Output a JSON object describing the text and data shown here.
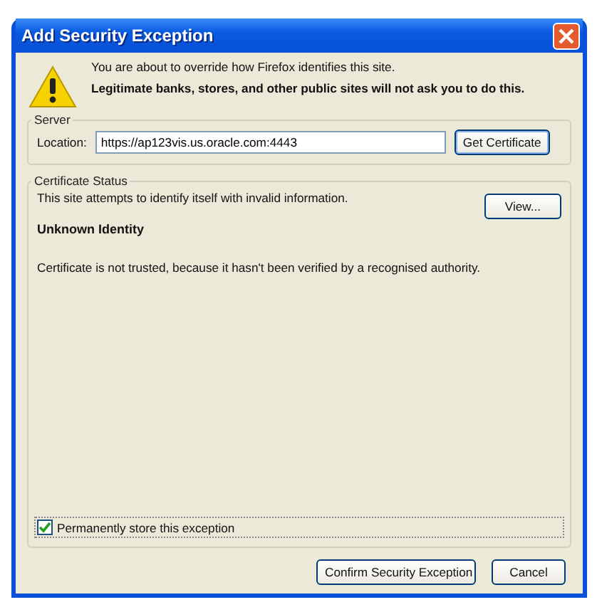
{
  "window": {
    "title": "Add Security Exception"
  },
  "warning": {
    "line_1": "You are about to override how Firefox identifies this site.",
    "line_2": "Legitimate banks, stores, and other public sites will not ask you to do this."
  },
  "server": {
    "legend": "Server",
    "location_label": "Location:",
    "location_value": "https://ap123vis.us.oracle.com:4443",
    "button": "Get Certificate"
  },
  "certificate_status": {
    "legend": "Certificate Status",
    "summary": "This site attempts to identify itself with invalid information.",
    "view_button": "View...",
    "heading": "Unknown Identity",
    "detail": "Certificate is not trusted, because it hasn't been verified by a recognised authority.",
    "permanent": {
      "label": "Permanently store this exception",
      "checked": true
    }
  },
  "buttons": [
    "Confirm Security Exception",
    "Cancel"
  ]
}
